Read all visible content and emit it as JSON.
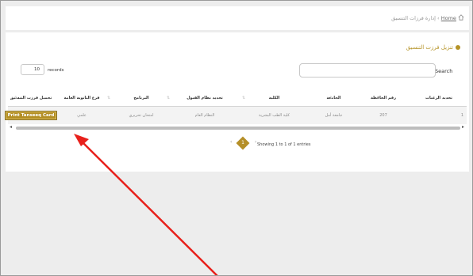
{
  "breadcrumb": {
    "home": "Home",
    "separator": "›",
    "current": "إدارة فرزات التنسيق"
  },
  "section": {
    "title": "تنزيل فرزت التنسيق"
  },
  "search": {
    "label": "Search",
    "placeholder": "",
    "value": ""
  },
  "length": {
    "value": "10",
    "label": "records"
  },
  "table": {
    "columns": [
      "تحديد الرغبات",
      "رقم الحافظة",
      "الجامعة",
      "الكلية",
      "تحديد نظام القبول",
      "البرنامج",
      "فرع الثانوية العامة",
      "تحميل فرزت التنسيق"
    ],
    "rows": [
      {
        "index": "1",
        "wallet": "207",
        "university": "جامعة أمل",
        "faculty": "كلية الطب البشرية",
        "admission": "النظام العام",
        "program": "امتحان تحريري",
        "branch": "علمي",
        "action": "Print Tanseeq Card"
      }
    ]
  },
  "pagination": {
    "info": "Showing 1 to 1 of 1 entries",
    "current": "1",
    "prev": "‹",
    "next": "›"
  },
  "colors": {
    "accent": "#b38e24",
    "annotation": "#e8201b"
  }
}
